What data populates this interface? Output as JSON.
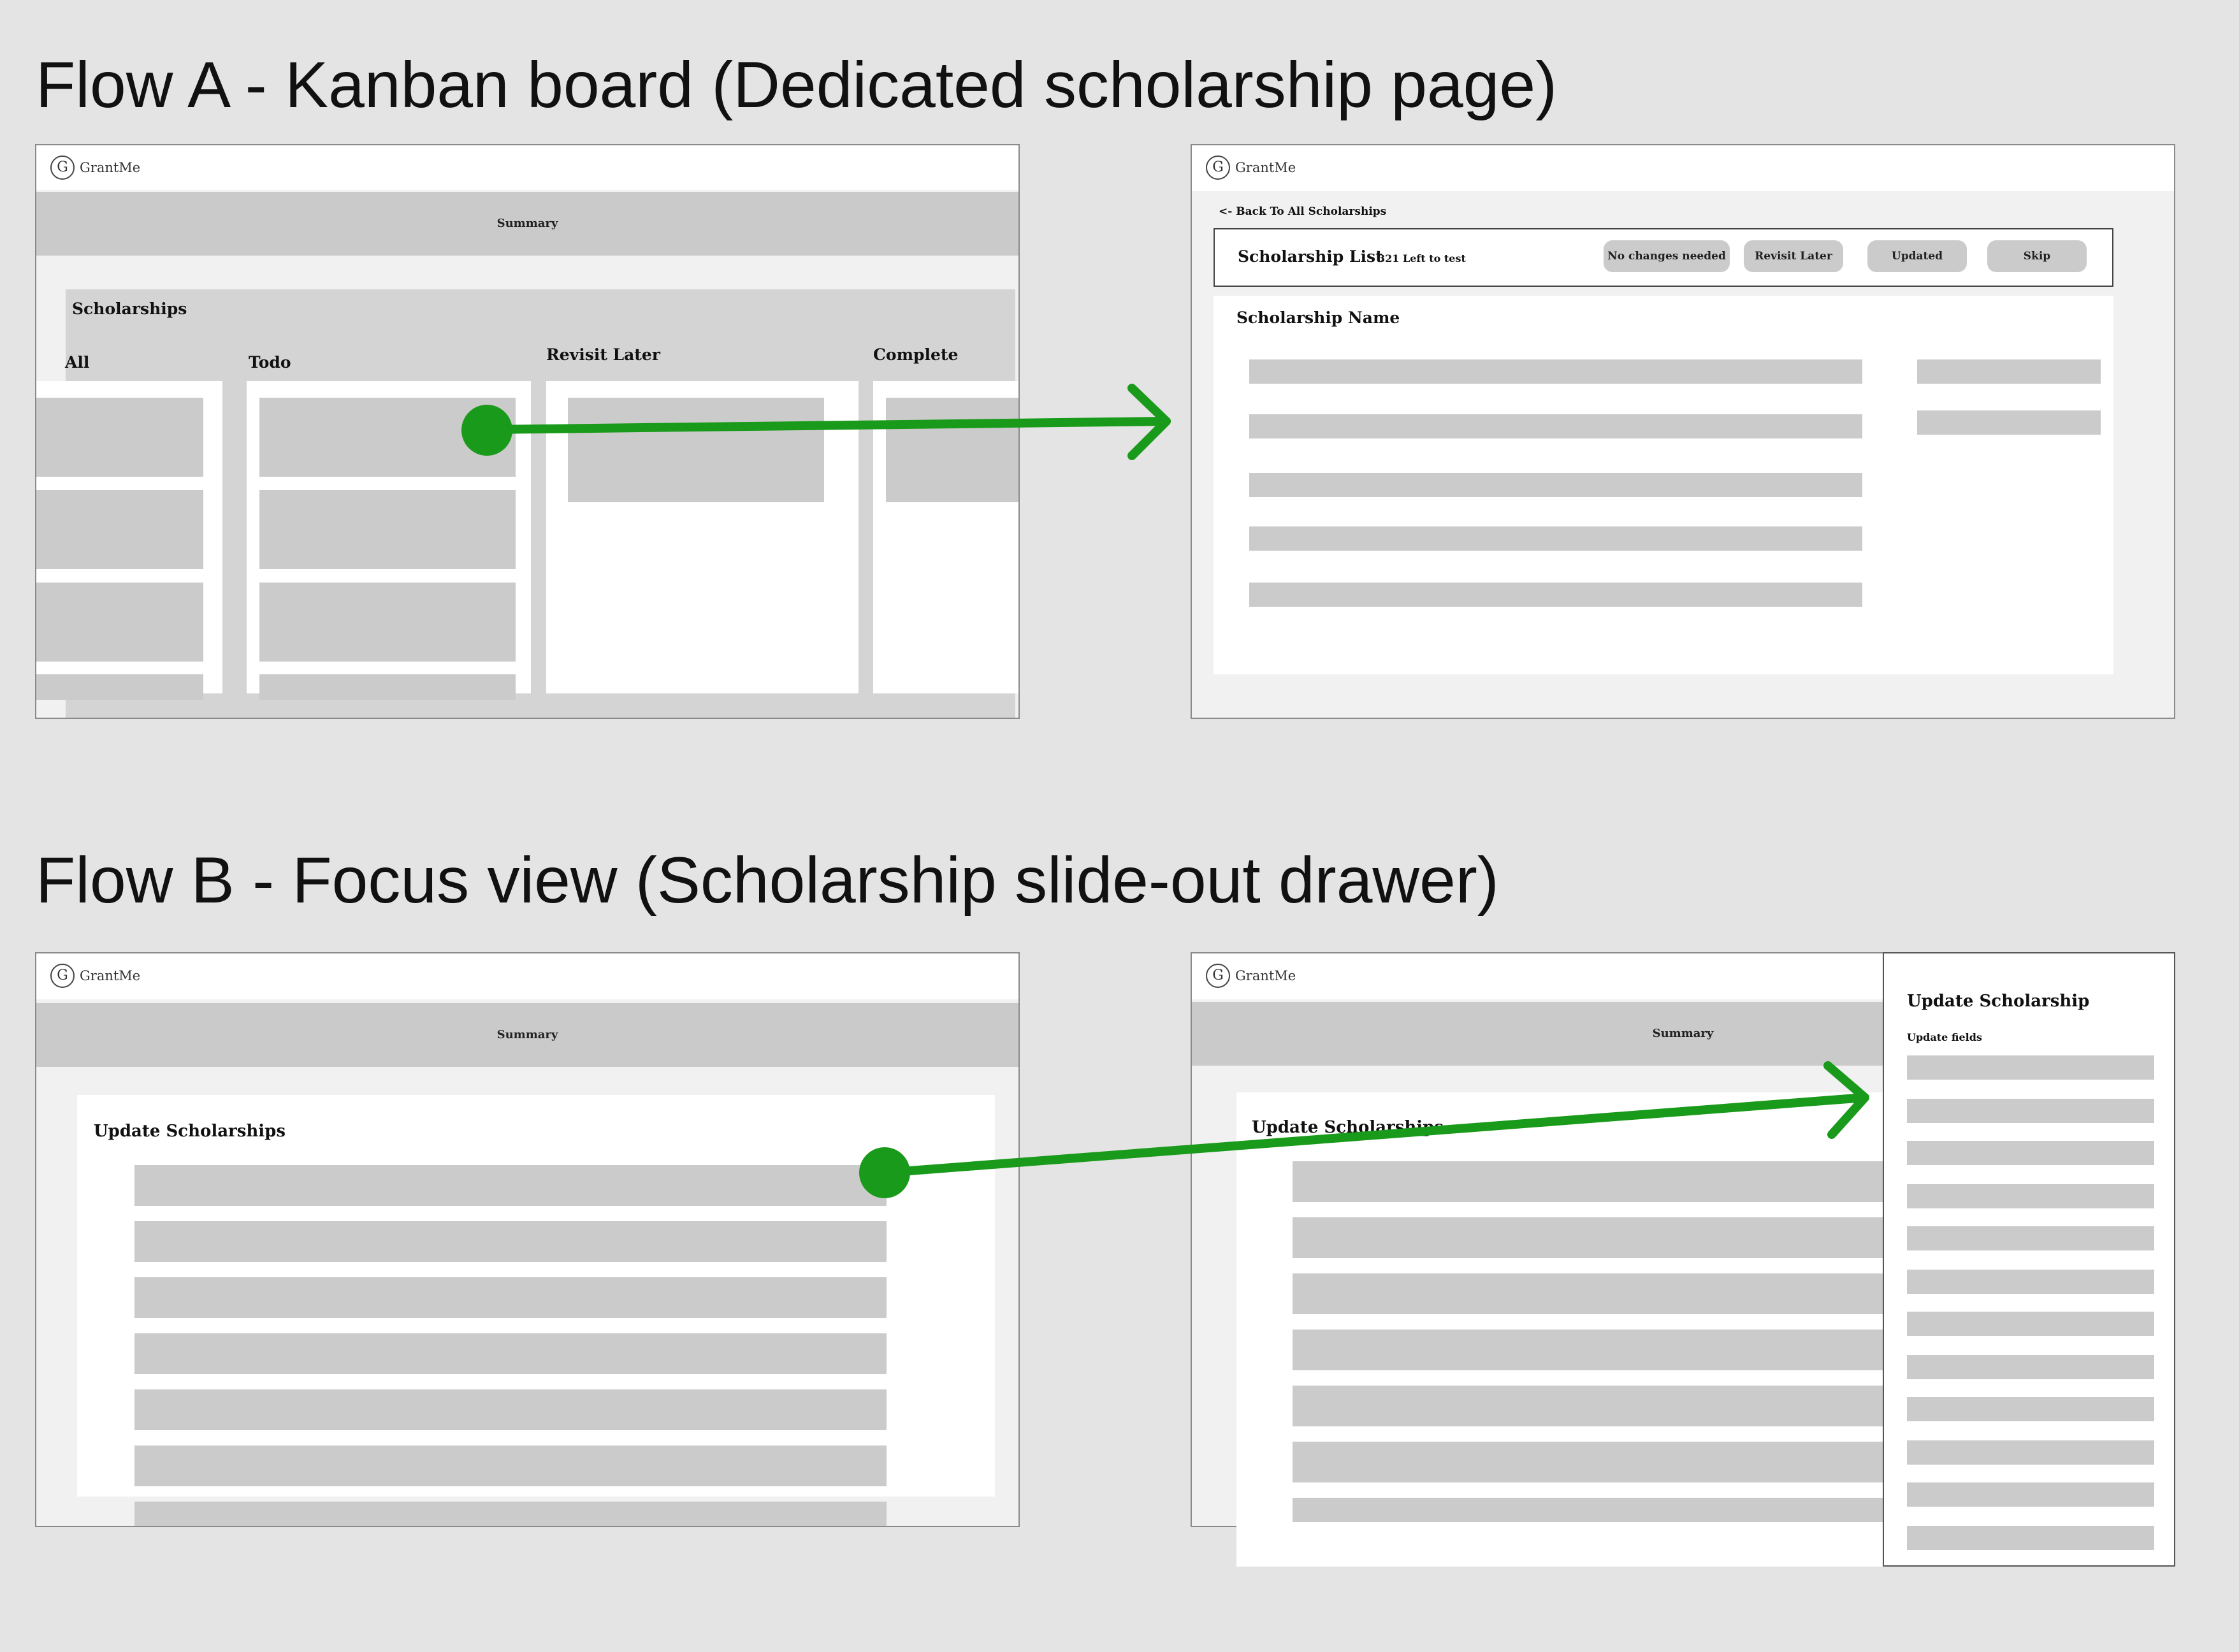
{
  "flow_a": {
    "title": "Flow A - Kanban board (Dedicated scholarship page)",
    "board": {
      "logo_text": "GrantMe",
      "logo_glyph": "G",
      "summary_label": "Summary",
      "section_title": "Scholarships",
      "columns": [
        "All",
        "Todo",
        "Revisit Later",
        "Complete"
      ]
    },
    "detail": {
      "logo_text": "GrantMe",
      "logo_glyph": "G",
      "back_link": "<- Back To All Scholarships",
      "list_title": "Scholarship List",
      "left_count": "321 Left to test",
      "buttons": [
        "No changes needed",
        "Revisit Later",
        "Updated",
        "Skip"
      ],
      "scholarship_name": "Scholarship Name"
    }
  },
  "flow_b": {
    "title": "Flow B - Focus view (Scholarship slide-out drawer)",
    "list": {
      "logo_text": "GrantMe",
      "logo_glyph": "G",
      "summary_label": "Summary",
      "section_title": "Update Scholarships"
    },
    "drawer_view": {
      "logo_text": "GrantMe",
      "logo_glyph": "G",
      "summary_label": "Summary",
      "section_title": "Update Scholarships",
      "drawer_title": "Update Scholarship",
      "drawer_subtitle": "Update fields"
    }
  },
  "colors": {
    "arrow": "#1a9a1a",
    "placeholder_bar": "#cbcbcb",
    "background": "#e4e4e4"
  },
  "icons": [
    "grantme-logo-icon",
    "arrow-right-icon",
    "start-dot-icon"
  ]
}
